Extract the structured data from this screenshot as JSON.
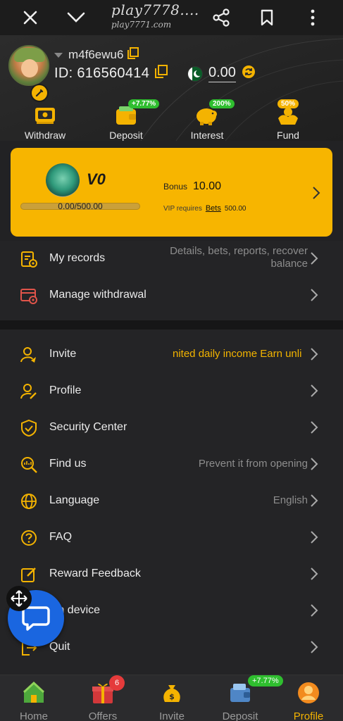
{
  "browser": {
    "site_title": "play7778....",
    "site_url": "play7771.com"
  },
  "header": {
    "username": "m4f6ewu6",
    "id_label": "ID: 616560414",
    "balance": "0.00"
  },
  "actions": [
    {
      "label": "Withdraw",
      "badge": ""
    },
    {
      "label": "Deposit",
      "badge": "+7.77%"
    },
    {
      "label": "Interest",
      "badge": "200%"
    },
    {
      "label": "Fund",
      "badge": "50%"
    }
  ],
  "vip": {
    "level": "V0",
    "progress_text": "0.00/500.00",
    "progress_fraction": 0,
    "bonus_label": "Bonus",
    "bonus_value": "10.00",
    "requires_label": "VIP requires",
    "bets_link": "Bets",
    "requires_amount": "500.00"
  },
  "group1": [
    {
      "label": "My records",
      "value_line1": "Details, bets, reports, recover",
      "value_line2": "balance"
    },
    {
      "label": "Manage withdrawal",
      "value": ""
    }
  ],
  "group2": [
    {
      "label": "Invite",
      "value": "nited daily income  Earn unli"
    },
    {
      "label": "Profile",
      "value": ""
    },
    {
      "label": "Security Center",
      "value": ""
    },
    {
      "label": "Find us",
      "value": "Prevent it from opening"
    },
    {
      "label": "Language",
      "value": "English"
    },
    {
      "label": "FAQ",
      "value": ""
    },
    {
      "label": "Reward Feedback",
      "value": ""
    },
    {
      "label": "gin device",
      "value": ""
    },
    {
      "label": "Quit",
      "value": ""
    }
  ],
  "tabs": [
    {
      "label": "Home"
    },
    {
      "label": "Offers",
      "badge": "6"
    },
    {
      "label": "Invite"
    },
    {
      "label": "Deposit",
      "badge": "+7.77%"
    },
    {
      "label": "Profile"
    }
  ],
  "colors": {
    "accent": "#f4b301",
    "background": "#222224",
    "promo_green": "#2fbe2f",
    "chat_blue": "#1a66e0"
  }
}
